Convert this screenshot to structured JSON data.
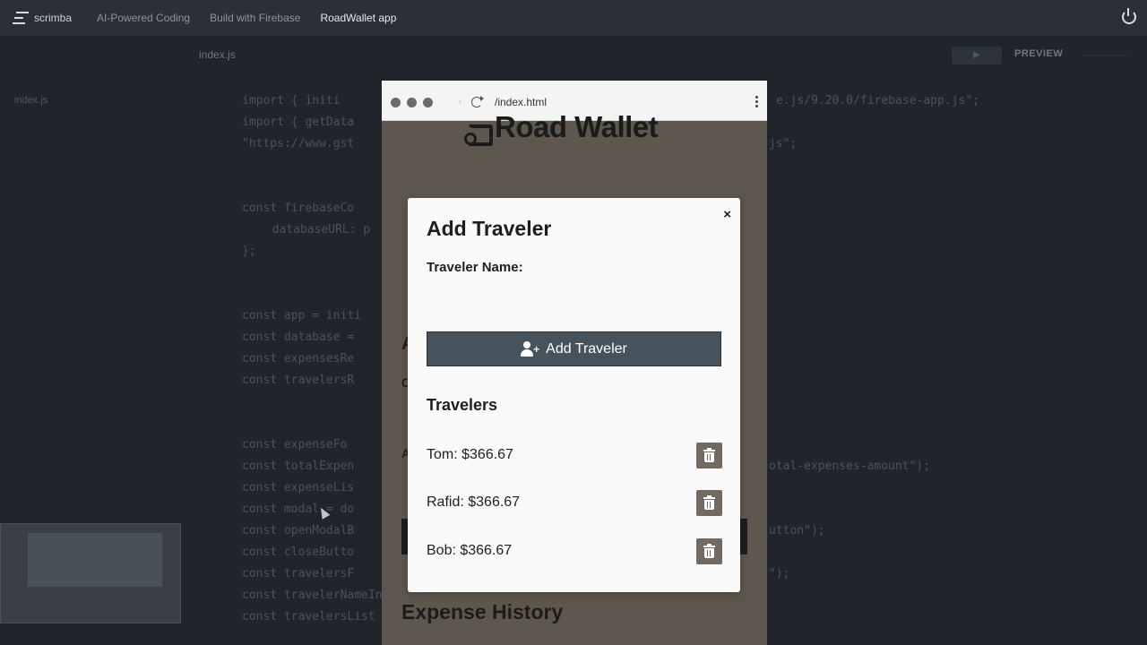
{
  "topnav": {
    "brand": "scrimba",
    "crumbs": [
      "AI-Powered Coding",
      "Build with Firebase",
      "RoadWallet app"
    ]
  },
  "editor": {
    "file_tab": "index.js",
    "preview_label": "PREVIEW",
    "sidebar_file": "index.js",
    "code_lines": [
      "import { initi",
      "import { getData",
      "\"https://www.gst",
      "const firebaseCo",
      "  databaseURL: p",
      "};",
      "const app = initi",
      "const database =",
      "const expensesRe",
      "const travelersR",
      "const expenseFo",
      "const totalExpen",
      "const expenseLis",
      "const modal = do",
      "const openModalB",
      "const closeButto",
      "const travelersF",
      "const travelerNameInput = document.getElementById(\"traveler-name\");",
      "const travelersList = document.getElementById(\"travelers-list\");"
    ],
    "code_right": [
      "e.js/9.20.0/firebase-app.js\";",
      "js\";",
      "otal-expenses-amount\");",
      "utton\");",
      "\");"
    ]
  },
  "browser": {
    "url": "/index.html",
    "app_title": "Road Wallet",
    "bg_heading_a": "A",
    "bg_heading_b": "C",
    "bg_heading_c": "A",
    "expense_history": "Expense History"
  },
  "modal": {
    "title": "Add Traveler",
    "close": "×",
    "name_label": "Traveler Name:",
    "name_value": "",
    "add_button": "Add Traveler",
    "travelers_title": "Travelers",
    "travelers": [
      {
        "name": "Tom",
        "amount": "$366.67",
        "label": "Tom: $366.67"
      },
      {
        "name": "Rafid",
        "amount": "$366.67",
        "label": "Rafid: $366.67"
      },
      {
        "name": "Bob",
        "amount": "$366.67",
        "label": "Bob: $366.67"
      }
    ]
  },
  "colors": {
    "topbar": "#2b3038",
    "editor_bg": "#20252c",
    "preview_bg": "#5e574d",
    "button_dark": "#46535d",
    "delete_button": "#716a61"
  }
}
